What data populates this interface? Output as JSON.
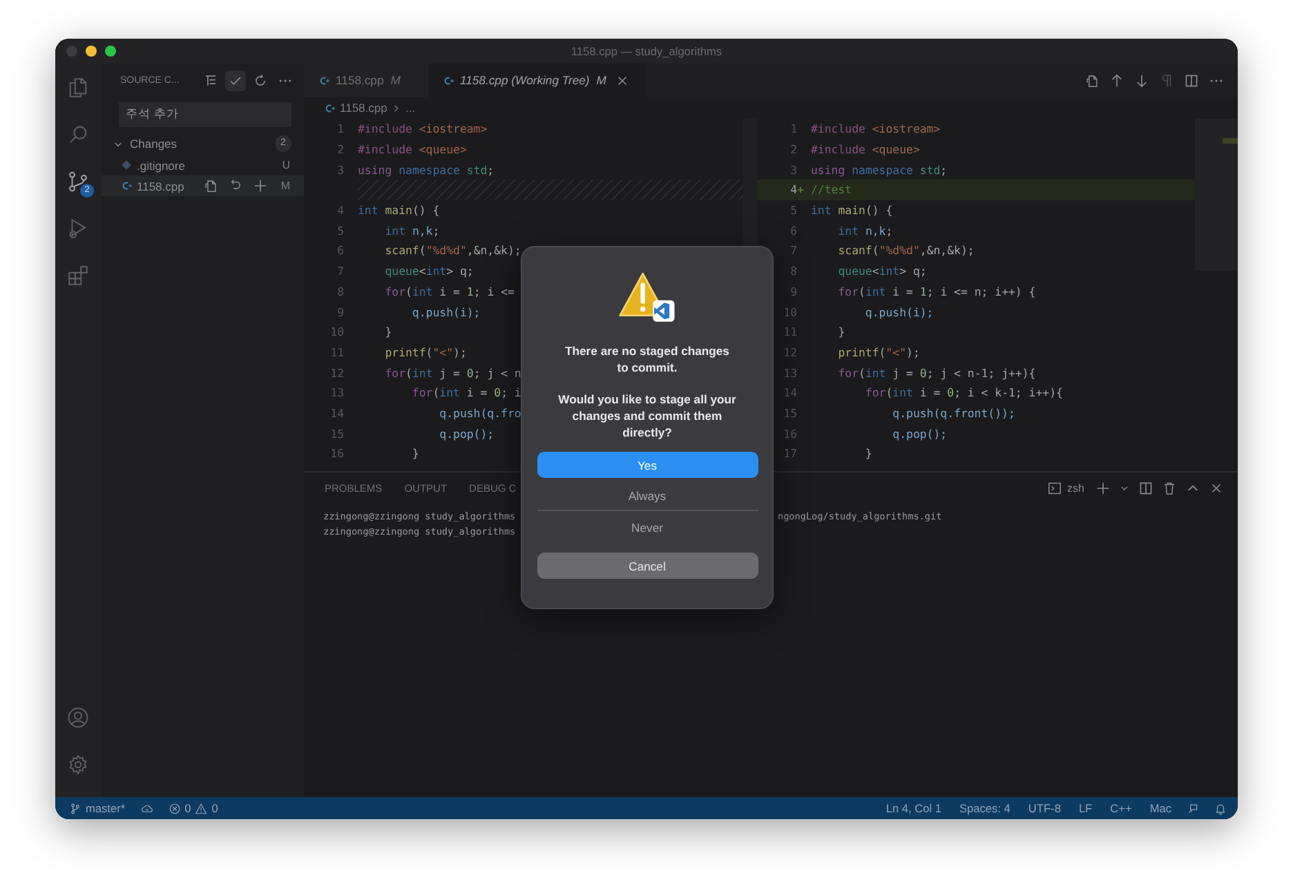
{
  "window": {
    "title": "1158.cpp — study_algorithms"
  },
  "activity_bar": {
    "items": [
      {
        "kind": "explorer",
        "selected": false
      },
      {
        "kind": "search",
        "selected": false
      },
      {
        "kind": "source-control",
        "selected": true,
        "badge": "2"
      },
      {
        "kind": "run",
        "selected": false
      },
      {
        "kind": "extensions",
        "selected": false
      }
    ],
    "bottom": [
      {
        "kind": "account"
      },
      {
        "kind": "settings"
      }
    ]
  },
  "sidebar": {
    "title": "SOURCE C...",
    "message": {
      "value": "주석 추가"
    },
    "changes": {
      "label": "Changes",
      "count": "2",
      "expanded": true,
      "files": [
        {
          "name": ".gitignore",
          "kind": "git",
          "status": "U",
          "selected": false
        },
        {
          "name": "1158.cpp",
          "kind": "cpp",
          "status": "M",
          "selected": true
        }
      ]
    }
  },
  "tabs": [
    {
      "label": "1158.cpp",
      "status": "M",
      "preview": false,
      "selected": false
    },
    {
      "label": "1158.cpp (Working Tree)",
      "status": "M",
      "preview": true,
      "selected": true
    }
  ],
  "breadcrumb": [
    "1158.cpp",
    "..."
  ],
  "diff": {
    "left": [
      {
        "kind": "code",
        "n": "1",
        "tokens": [
          {
            "text": "#include",
            "kind": "pp"
          },
          {
            "text": " <iostream>",
            "kind": "str"
          }
        ]
      },
      {
        "kind": "code",
        "n": "2",
        "tokens": [
          {
            "text": "#include",
            "kind": "pp"
          },
          {
            "text": " <queue>",
            "kind": "str"
          }
        ]
      },
      {
        "kind": "code",
        "n": "3",
        "tokens": [
          {
            "text": "using",
            "kind": "kw"
          },
          {
            "text": " namespace",
            "kind": "type"
          },
          {
            "text": " std",
            "kind": "ns"
          },
          {
            "text": ";",
            "kind": "p"
          }
        ]
      },
      {
        "kind": "filler"
      },
      {
        "kind": "code",
        "n": "4",
        "tokens": [
          {
            "text": "int",
            "kind": "type"
          },
          {
            "text": " main",
            "kind": "fn"
          },
          {
            "text": "() {",
            "kind": "p"
          }
        ]
      },
      {
        "kind": "code",
        "n": "5",
        "tokens": [
          {
            "text": "    int",
            "kind": "type"
          },
          {
            "text": " n,k",
            "kind": "var"
          },
          {
            "text": ";",
            "kind": "p"
          }
        ]
      },
      {
        "kind": "code",
        "n": "6",
        "tokens": [
          {
            "text": "    scanf",
            "kind": "fn"
          },
          {
            "text": "(",
            "kind": "p"
          },
          {
            "text": "\"%d%d\"",
            "kind": "str"
          },
          {
            "text": ",&n,&k);",
            "kind": "p"
          }
        ]
      },
      {
        "kind": "code",
        "n": "7",
        "tokens": [
          {
            "text": "    queue",
            "kind": "ns"
          },
          {
            "text": "<",
            "kind": "p"
          },
          {
            "text": "int",
            "kind": "type"
          },
          {
            "text": "> q;",
            "kind": "p"
          }
        ]
      },
      {
        "kind": "code",
        "n": "8",
        "tokens": [
          {
            "text": "    for",
            "kind": "kw"
          },
          {
            "text": "(",
            "kind": "p"
          },
          {
            "text": "int",
            "kind": "type"
          },
          {
            "text": " i = ",
            "kind": "p"
          },
          {
            "text": "1",
            "kind": "num"
          },
          {
            "text": "; i <=",
            "kind": "p"
          }
        ]
      },
      {
        "kind": "code",
        "n": "9",
        "tokens": [
          {
            "text": "        q.push(i);",
            "kind": "var"
          }
        ]
      },
      {
        "kind": "code",
        "n": "10",
        "tokens": [
          {
            "text": "    }",
            "kind": "p"
          }
        ]
      },
      {
        "kind": "code",
        "n": "11",
        "tokens": [
          {
            "text": "    printf",
            "kind": "fn"
          },
          {
            "text": "(",
            "kind": "p"
          },
          {
            "text": "\"<\"",
            "kind": "str"
          },
          {
            "text": ");",
            "kind": "p"
          }
        ]
      },
      {
        "kind": "code",
        "n": "12",
        "tokens": [
          {
            "text": "    for",
            "kind": "kw"
          },
          {
            "text": "(",
            "kind": "p"
          },
          {
            "text": "int",
            "kind": "type"
          },
          {
            "text": " j = ",
            "kind": "p"
          },
          {
            "text": "0",
            "kind": "num"
          },
          {
            "text": "; j < n",
            "kind": "p"
          }
        ]
      },
      {
        "kind": "code",
        "n": "13",
        "tokens": [
          {
            "text": "        for",
            "kind": "kw"
          },
          {
            "text": "(",
            "kind": "p"
          },
          {
            "text": "int",
            "kind": "type"
          },
          {
            "text": " i = ",
            "kind": "p"
          },
          {
            "text": "0",
            "kind": "num"
          },
          {
            "text": "; i",
            "kind": "p"
          }
        ]
      },
      {
        "kind": "code",
        "n": "14",
        "tokens": [
          {
            "text": "            q.push(q.fro",
            "kind": "var"
          }
        ]
      },
      {
        "kind": "code",
        "n": "15",
        "tokens": [
          {
            "text": "            q.pop();",
            "kind": "var"
          }
        ]
      },
      {
        "kind": "code",
        "n": "16",
        "tokens": [
          {
            "text": "        }",
            "kind": "p"
          }
        ]
      }
    ],
    "right": [
      {
        "kind": "code",
        "n": "1",
        "tokens": [
          {
            "text": "#include",
            "kind": "pp"
          },
          {
            "text": " <iostream>",
            "kind": "str"
          }
        ]
      },
      {
        "kind": "code",
        "n": "2",
        "tokens": [
          {
            "text": "#include",
            "kind": "pp"
          },
          {
            "text": " <queue>",
            "kind": "str"
          }
        ]
      },
      {
        "kind": "code",
        "n": "3",
        "tokens": [
          {
            "text": "using",
            "kind": "kw"
          },
          {
            "text": " namespace",
            "kind": "type"
          },
          {
            "text": " std",
            "kind": "ns"
          },
          {
            "text": ";",
            "kind": "p"
          }
        ]
      },
      {
        "kind": "added",
        "n": "4",
        "marker": "+",
        "tokens": [
          {
            "text": "//test",
            "kind": "com"
          }
        ]
      },
      {
        "kind": "code",
        "n": "5",
        "tokens": [
          {
            "text": "int",
            "kind": "type"
          },
          {
            "text": " main",
            "kind": "fn"
          },
          {
            "text": "() {",
            "kind": "p"
          }
        ]
      },
      {
        "kind": "code",
        "n": "6",
        "tokens": [
          {
            "text": "    int",
            "kind": "type"
          },
          {
            "text": " n,k",
            "kind": "var"
          },
          {
            "text": ";",
            "kind": "p"
          }
        ]
      },
      {
        "kind": "code",
        "n": "7",
        "tokens": [
          {
            "text": "    scanf",
            "kind": "fn"
          },
          {
            "text": "(",
            "kind": "p"
          },
          {
            "text": "\"%d%d\"",
            "kind": "str"
          },
          {
            "text": ",&n,&k);",
            "kind": "p"
          }
        ]
      },
      {
        "kind": "code",
        "n": "8",
        "tokens": [
          {
            "text": "    queue",
            "kind": "ns"
          },
          {
            "text": "<",
            "kind": "p"
          },
          {
            "text": "int",
            "kind": "type"
          },
          {
            "text": "> q;",
            "kind": "p"
          }
        ]
      },
      {
        "kind": "code",
        "n": "9",
        "tokens": [
          {
            "text": "    for",
            "kind": "kw"
          },
          {
            "text": "(",
            "kind": "p"
          },
          {
            "text": "int",
            "kind": "type"
          },
          {
            "text": " i = ",
            "kind": "p"
          },
          {
            "text": "1",
            "kind": "num"
          },
          {
            "text": "; i <= n; i++) {",
            "kind": "p"
          }
        ]
      },
      {
        "kind": "code",
        "n": "10",
        "tokens": [
          {
            "text": "        q.push(i);",
            "kind": "var"
          }
        ]
      },
      {
        "kind": "code",
        "n": "11",
        "tokens": [
          {
            "text": "    }",
            "kind": "p"
          }
        ]
      },
      {
        "kind": "code",
        "n": "12",
        "tokens": [
          {
            "text": "    printf",
            "kind": "fn"
          },
          {
            "text": "(",
            "kind": "p"
          },
          {
            "text": "\"<\"",
            "kind": "str"
          },
          {
            "text": ");",
            "kind": "p"
          }
        ]
      },
      {
        "kind": "code",
        "n": "13",
        "tokens": [
          {
            "text": "    for",
            "kind": "kw"
          },
          {
            "text": "(",
            "kind": "p"
          },
          {
            "text": "int",
            "kind": "type"
          },
          {
            "text": " j = ",
            "kind": "p"
          },
          {
            "text": "0",
            "kind": "num"
          },
          {
            "text": "; j < n-1; j++){",
            "kind": "p"
          }
        ]
      },
      {
        "kind": "code",
        "n": "14",
        "tokens": [
          {
            "text": "        for",
            "kind": "kw"
          },
          {
            "text": "(",
            "kind": "p"
          },
          {
            "text": "int",
            "kind": "type"
          },
          {
            "text": " i = ",
            "kind": "p"
          },
          {
            "text": "0",
            "kind": "num"
          },
          {
            "text": "; i < k-1; i++){",
            "kind": "p"
          }
        ]
      },
      {
        "kind": "code",
        "n": "15",
        "tokens": [
          {
            "text": "            q.push(q.front());",
            "kind": "var"
          }
        ]
      },
      {
        "kind": "code",
        "n": "16",
        "tokens": [
          {
            "text": "            q.pop();",
            "kind": "var"
          }
        ]
      },
      {
        "kind": "code",
        "n": "17",
        "tokens": [
          {
            "text": "        }",
            "kind": "p"
          }
        ]
      }
    ]
  },
  "panel": {
    "tabs": [
      {
        "label": "PROBLEMS",
        "selected": false
      },
      {
        "label": "OUTPUT",
        "selected": false
      },
      {
        "label": "DEBUG C",
        "selected": false
      }
    ],
    "shell": "zsh",
    "lines": [
      {
        "left": "zzingong@zzingong study_algorithms",
        "right": "ngongLog/study_algorithms.git"
      },
      {
        "left": "zzingong@zzingong study_algorithms"
      }
    ]
  },
  "status_bar": {
    "branch": "master*",
    "errors": "0",
    "warnings": "0",
    "items": [
      "Ln 4, Col 1",
      "Spaces: 4",
      "UTF-8",
      "LF",
      "C++",
      "Mac"
    ]
  },
  "dialog": {
    "title": "There are no staged changes to commit.",
    "message": "Would you like to stage all your changes and commit them directly?",
    "buttons": [
      {
        "label": "Yes",
        "kind": "primary"
      },
      {
        "label": "Always",
        "kind": "plain"
      },
      {
        "label": "Never",
        "kind": "plain"
      },
      {
        "label": "Cancel",
        "kind": "cancel"
      }
    ]
  }
}
